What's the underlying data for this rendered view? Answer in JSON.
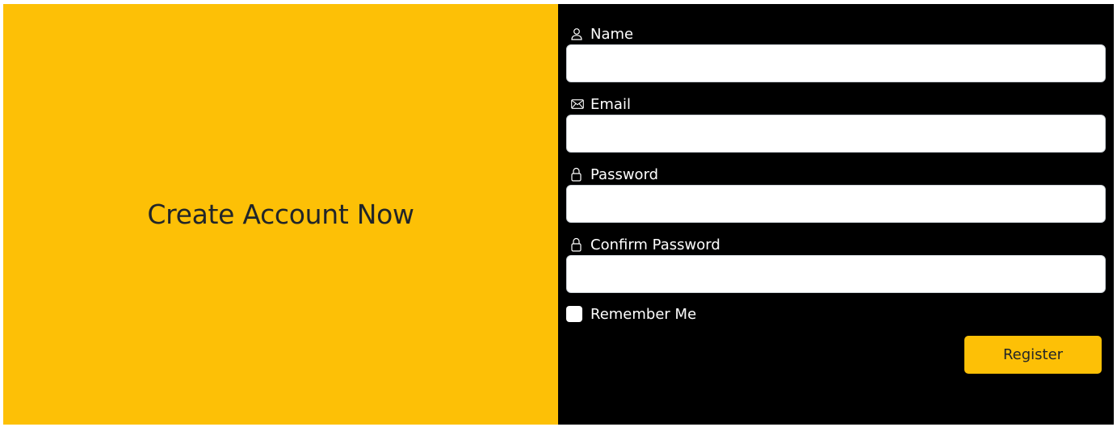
{
  "hero": {
    "title": "Create Account Now"
  },
  "form": {
    "fields": [
      {
        "label": "Name",
        "icon": "person-icon",
        "value": "",
        "placeholder": ""
      },
      {
        "label": "Email",
        "icon": "envelope-icon",
        "value": "",
        "placeholder": ""
      },
      {
        "label": "Password",
        "icon": "lock-icon",
        "value": "",
        "placeholder": ""
      },
      {
        "label": "Confirm Password",
        "icon": "lock-icon",
        "value": "",
        "placeholder": ""
      }
    ],
    "remember_label": "Remember Me",
    "remember_checked": false,
    "submit_label": "Register"
  },
  "colors": {
    "accent": "#fdc006",
    "form_background": "#000000",
    "title_text": "#212529"
  }
}
